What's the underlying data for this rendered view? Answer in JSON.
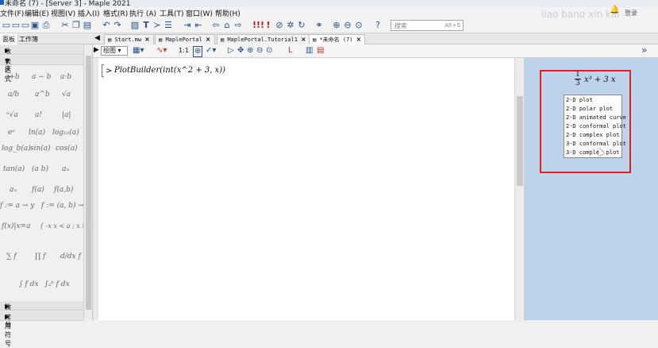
{
  "window": {
    "title": "未命名 (7) - [Server 3] - Maple 2021"
  },
  "menubar": {
    "items": [
      "文件(F)",
      "编辑(E)",
      "视图(V)",
      "插入(I)",
      "格式(R)",
      "执行 (A)",
      "工具(T)",
      "窗口(W)",
      "帮助(H)"
    ],
    "watermark": "jiao bang xin kai",
    "login": "登录"
  },
  "search": {
    "placeholder": "搜索",
    "shortcut": "Alt+S"
  },
  "left_panel": {
    "tabs": [
      "面板",
      "工作簿"
    ],
    "favorites": "收藏夹",
    "expression": "表达式",
    "calculus": "微积分",
    "common_symbols": "常用符号"
  },
  "palette": [
    "a+b",
    "a − b",
    "a·b",
    "a/b",
    "a^b",
    "√a",
    "ⁿ√a",
    "a!",
    "|a|",
    "eᵃ",
    "ln(a)",
    "log₁₀(a)",
    "log_b(a)",
    "sin(a)",
    "cos(a)",
    "tan(a)",
    "(a b)",
    "aₙ",
    "aₙ",
    "f(a)",
    "f(a,b)",
    "f := a → y",
    "f := (a, b) → z",
    "f(x)|x=a",
    "{ -x x < a ; x x ≥ a }",
    "∑ f",
    "∏ f",
    "d/dx f",
    "∫ f dx",
    "∫ₐᵇ f dx"
  ],
  "doc_tabs": [
    {
      "label": "Start.mw",
      "active": false
    },
    {
      "label": "MaplePortal",
      "active": false
    },
    {
      "label": "MaplePortal.Tutorial1",
      "active": false
    },
    {
      "label": "*未命名 (7)",
      "active": true
    }
  ],
  "toolbar2": {
    "plot_dropdown": "绘图",
    "zoom_label": "1:1"
  },
  "editor": {
    "prompt": ">",
    "command": "PlotBuilder(int(x^2 + 3, x))"
  },
  "context_panel": {
    "expr_num": "1",
    "expr_den": "3",
    "expr_rest": "x³ + 3 x",
    "menu_items": [
      "2-D plot",
      "2-D polar plot",
      "2-D animated curve",
      "2-D conformal plot",
      "2-D complex plot",
      "3-D conformal plot",
      "3-D complex plot"
    ]
  }
}
